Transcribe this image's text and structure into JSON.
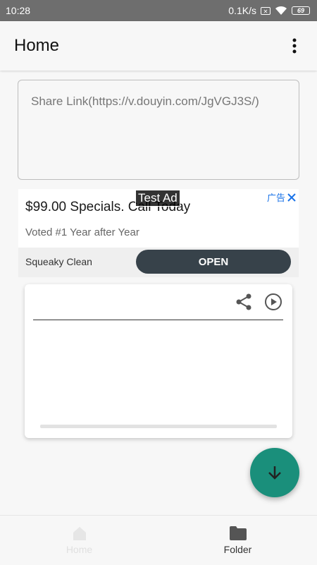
{
  "status_bar": {
    "time": "10:28",
    "speed": "0.1K/s",
    "battery": "69"
  },
  "toolbar": {
    "title": "Home"
  },
  "share_link": {
    "placeholder": "Share Link(https://v.douyin.com/JgVGJ3S/)"
  },
  "ad": {
    "test_label": "Test Ad",
    "headline": "$99.00 Specials. Call Today",
    "subtext": "Voted #1 Year after Year",
    "badge": "广告",
    "advertiser": "Squeaky Clean",
    "cta": "OPEN"
  },
  "bottom_nav": {
    "items": [
      {
        "label": "Home",
        "icon": "home-icon"
      },
      {
        "label": "Folder",
        "icon": "folder-icon"
      }
    ]
  },
  "colors": {
    "fab": "#1a8f7b",
    "ad_cta": "#37424a",
    "ad_badge": "#1a73e8"
  }
}
